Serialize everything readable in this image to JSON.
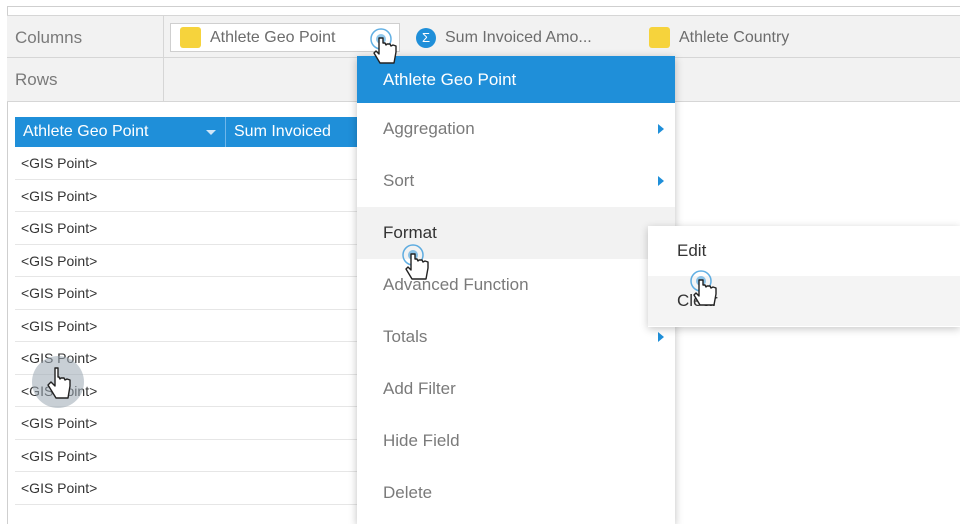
{
  "shelves": {
    "columns_label": "Columns",
    "rows_label": "Rows",
    "column_pills": [
      {
        "label": "Athlete Geo Point",
        "icon": "yellow-swatch"
      },
      {
        "label": "Sum Invoiced Amo...",
        "icon": "sigma"
      },
      {
        "label": "Athlete Country",
        "icon": "yellow-swatch"
      }
    ]
  },
  "table": {
    "headers": [
      "Athlete Geo Point",
      "Sum Invoiced"
    ],
    "rows": [
      "<GIS Point>",
      "<GIS Point>",
      "<GIS Point>",
      "<GIS Point>",
      "<GIS Point>",
      "<GIS Point>",
      "<GIS Point>",
      "<GIS Point>",
      "<GIS Point>",
      "<GIS Point>",
      "<GIS Point>"
    ]
  },
  "context_menu": {
    "title": "Athlete Geo Point",
    "items": [
      {
        "label": "Aggregation",
        "submenu": true
      },
      {
        "label": "Sort",
        "submenu": true
      },
      {
        "label": "Format",
        "submenu": false
      },
      {
        "label": "Advanced Function",
        "submenu": false
      },
      {
        "label": "Totals",
        "submenu": true
      },
      {
        "label": "Add Filter",
        "submenu": false
      },
      {
        "label": "Hide Field",
        "submenu": false
      },
      {
        "label": "Delete",
        "submenu": false
      }
    ]
  },
  "format_submenu": {
    "items": [
      "Edit",
      "Clear"
    ]
  },
  "colors": {
    "accent": "#1f8fd9",
    "swatch": "#f6d33c"
  }
}
